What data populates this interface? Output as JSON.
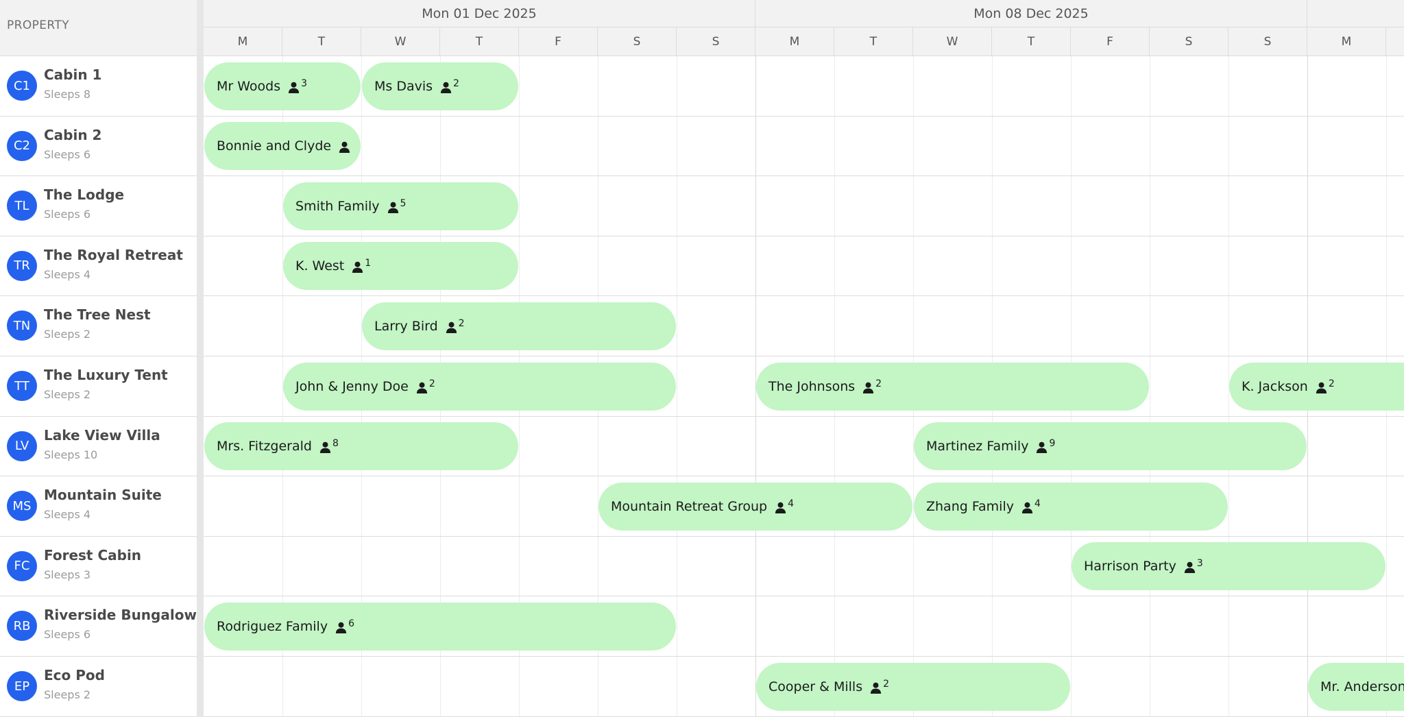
{
  "header": {
    "property_label": "PROPERTY",
    "weeks": [
      "Mon 01 Dec 2025",
      "Mon 08 Dec 2025"
    ],
    "days": [
      "M",
      "T",
      "W",
      "T",
      "F",
      "S",
      "S",
      "M",
      "T",
      "W",
      "T",
      "F",
      "S",
      "S",
      "M"
    ]
  },
  "colors": {
    "avatar": "#2462ee",
    "event": "#c3f5c5"
  },
  "icons": {
    "guest": "person-icon"
  },
  "resources": [
    {
      "initials": "C1",
      "name": "Cabin 1",
      "sleeps": "Sleeps 8",
      "events": [
        {
          "name": "Mr Woods",
          "guests": "3",
          "start": 0,
          "end": 2
        },
        {
          "name": "Ms Davis",
          "guests": "2",
          "start": 2,
          "end": 4
        }
      ]
    },
    {
      "initials": "C2",
      "name": "Cabin 2",
      "sleeps": "Sleeps 6",
      "events": [
        {
          "name": "Bonnie and Clyde",
          "guests": "",
          "start": 0,
          "end": 2
        }
      ]
    },
    {
      "initials": "TL",
      "name": "The Lodge",
      "sleeps": "Sleeps 6",
      "events": [
        {
          "name": "Smith Family",
          "guests": "5",
          "start": 1,
          "end": 4
        }
      ]
    },
    {
      "initials": "TR",
      "name": "The Royal Retreat",
      "sleeps": "Sleeps 4",
      "events": [
        {
          "name": "K. West",
          "guests": "1",
          "start": 1,
          "end": 4
        }
      ]
    },
    {
      "initials": "TN",
      "name": "The Tree Nest",
      "sleeps": "Sleeps 2",
      "events": [
        {
          "name": "Larry Bird",
          "guests": "2",
          "start": 2,
          "end": 6
        }
      ]
    },
    {
      "initials": "TT",
      "name": "The Luxury Tent",
      "sleeps": "Sleeps 2",
      "events": [
        {
          "name": "John & Jenny Doe",
          "guests": "2",
          "start": 1,
          "end": 6
        },
        {
          "name": "The Johnsons",
          "guests": "2",
          "start": 7,
          "end": 12
        },
        {
          "name": "K. Jackson",
          "guests": "2",
          "start": 13,
          "end": 16
        }
      ]
    },
    {
      "initials": "LV",
      "name": "Lake View Villa",
      "sleeps": "Sleeps 10",
      "events": [
        {
          "name": "Mrs. Fitzgerald",
          "guests": "8",
          "start": 0,
          "end": 4
        },
        {
          "name": "Martinez Family",
          "guests": "9",
          "start": 9,
          "end": 14
        }
      ]
    },
    {
      "initials": "MS",
      "name": "Mountain Suite",
      "sleeps": "Sleeps 4",
      "events": [
        {
          "name": "Mountain Retreat Group",
          "guests": "4",
          "start": 5,
          "end": 9
        },
        {
          "name": "Zhang Family",
          "guests": "4",
          "start": 9,
          "end": 13
        }
      ]
    },
    {
      "initials": "FC",
      "name": "Forest Cabin",
      "sleeps": "Sleeps 3",
      "events": [
        {
          "name": "Harrison Party",
          "guests": "3",
          "start": 11,
          "end": 15
        }
      ]
    },
    {
      "initials": "RB",
      "name": "Riverside Bungalow",
      "sleeps": "Sleeps 6",
      "events": [
        {
          "name": "Rodriguez Family",
          "guests": "6",
          "start": 0,
          "end": 6
        }
      ]
    },
    {
      "initials": "EP",
      "name": "Eco Pod",
      "sleeps": "Sleeps 2",
      "events": [
        {
          "name": "Cooper & Mills",
          "guests": "2",
          "start": 7,
          "end": 11
        },
        {
          "name": "Mr. Anderson",
          "guests": "",
          "start": 14,
          "end": 16
        }
      ]
    }
  ]
}
